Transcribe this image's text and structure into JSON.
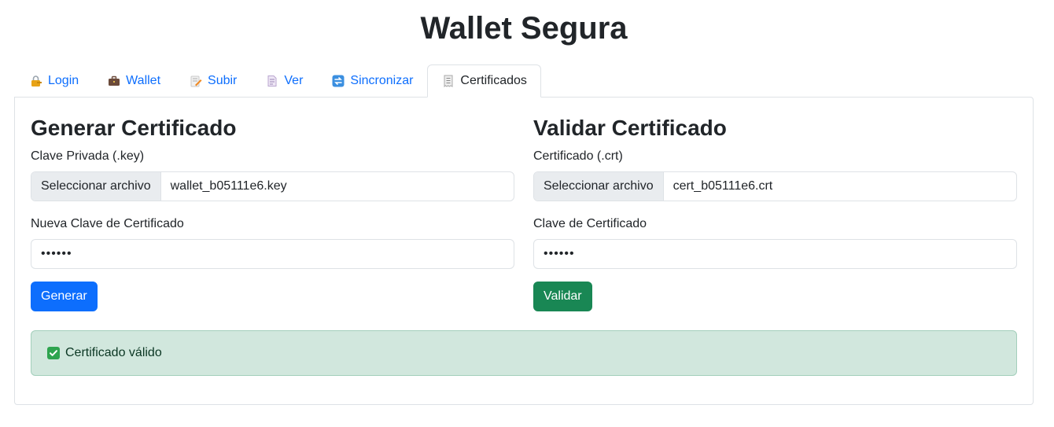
{
  "app": {
    "title": "Wallet Segura"
  },
  "tabs": [
    {
      "label": "Login",
      "icon": "lock-key-icon",
      "active": false
    },
    {
      "label": "Wallet",
      "icon": "briefcase-icon",
      "active": false
    },
    {
      "label": "Subir",
      "icon": "memo-pencil-icon",
      "active": false
    },
    {
      "label": "Ver",
      "icon": "document-icon",
      "active": false
    },
    {
      "label": "Sincronizar",
      "icon": "sync-icon",
      "active": false
    },
    {
      "label": "Certificados",
      "icon": "receipt-icon",
      "active": true
    }
  ],
  "generate": {
    "heading": "Generar Certificado",
    "key_label": "Clave Privada (.key)",
    "file_button": "Seleccionar archivo",
    "file_name": "wallet_b05111e6.key",
    "password_label": "Nueva Clave de Certificado",
    "password_value": "••••••",
    "submit_label": "Generar"
  },
  "validate": {
    "heading": "Validar Certificado",
    "cert_label": "Certificado (.crt)",
    "file_button": "Seleccionar archivo",
    "file_name": "cert_b05111e6.crt",
    "password_label": "Clave de Certificado",
    "password_value": "••••••",
    "submit_label": "Validar"
  },
  "alert": {
    "text": "Certificado válido",
    "icon": "check-mark-icon"
  },
  "colors": {
    "primary": "#0d6efd",
    "success": "#198754",
    "alert_bg": "#d1e7dd",
    "alert_text": "#0a3622"
  }
}
